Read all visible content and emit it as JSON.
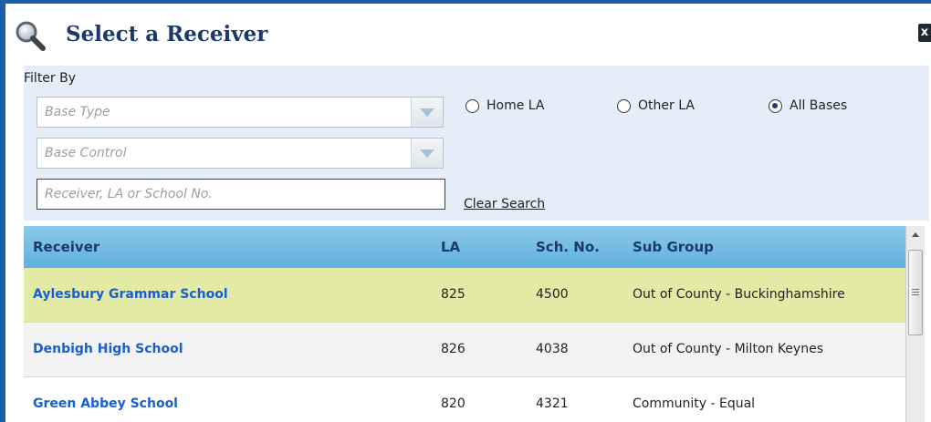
{
  "dialog": {
    "title": "Select a Receiver",
    "close_label": "x",
    "icon": "magnifier-icon"
  },
  "filter": {
    "label": "Filter By",
    "base_type_placeholder": "Base Type",
    "base_control_placeholder": "Base Control",
    "search_placeholder": "Receiver, LA or School No.",
    "search_value": "",
    "clear_label": "Clear Search",
    "radios": [
      {
        "label": "Home LA",
        "selected": false
      },
      {
        "label": "Other LA",
        "selected": false
      },
      {
        "label": "All Bases",
        "selected": true
      }
    ]
  },
  "grid": {
    "columns": [
      "Receiver",
      "LA",
      "Sch. No.",
      "Sub Group"
    ],
    "rows": [
      {
        "receiver": "Aylesbury Grammar School",
        "la": "825",
        "sch_no": "4500",
        "sub_group": "Out of County - Buckinghamshire"
      },
      {
        "receiver": "Denbigh High School",
        "la": "826",
        "sch_no": "4038",
        "sub_group": "Out of County - Milton Keynes"
      },
      {
        "receiver": "Green Abbey School",
        "la": "820",
        "sch_no": "4321",
        "sub_group": "Community - Equal"
      }
    ]
  },
  "colors": {
    "accent": "#1c5fa8",
    "header_gradient_top": "#8dc9ea",
    "header_gradient_bottom": "#5fb0de",
    "selected_row": "#e2eaa6",
    "alt_row": "#f3f3f3",
    "link": "#1a5fd0",
    "filter_bg": "#e5eef8"
  }
}
